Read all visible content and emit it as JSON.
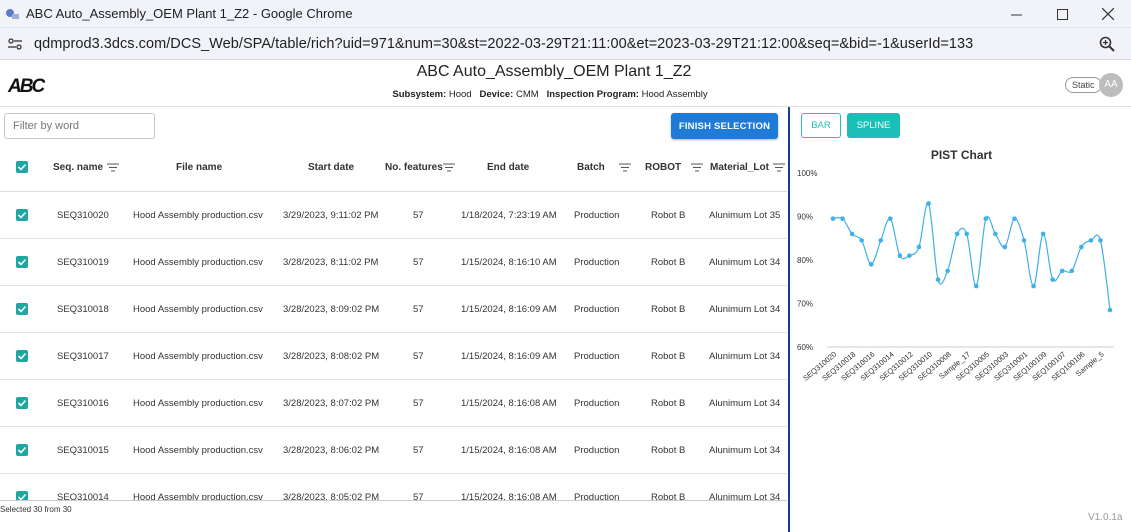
{
  "window": {
    "title": "ABC Auto_Assembly_OEM Plant 1_Z2 - Google Chrome",
    "url": "qdmprod3.3dcs.com/DCS_Web/SPA/table/rich?uid=971&num=30&st=2022-03-29T21:11:00&et=2023-03-29T21:12:00&seq=&bid=-1&userId=133"
  },
  "header": {
    "logo": "ABC",
    "title": "ABC Auto_Assembly_OEM Plant 1_Z2",
    "subsystem_label": "Subsystem:",
    "subsystem": "Hood",
    "device_label": "Device:",
    "device": "CMM",
    "program_label": "Inspection Program:",
    "program": "Hood Assembly",
    "badge": "Static",
    "avatar": "AA"
  },
  "toolbar": {
    "filter_placeholder": "Filter by word",
    "finish_label": "FINISH SELECTION"
  },
  "table": {
    "columns": {
      "seq": "Seq. name",
      "file": "File name",
      "start": "Start date",
      "features": "No. features",
      "end": "End date",
      "batch": "Batch",
      "robot": "ROBOT",
      "lot": "Material_Lot"
    },
    "rows": [
      {
        "seq": "SEQ310020",
        "file": "Hood Assembly production.csv",
        "start": "3/29/2023, 9:11:02 PM",
        "features": "57",
        "end": "1/18/2024, 7:23:19 AM",
        "batch": "Production",
        "robot": "Robot B",
        "lot": "Alunimum Lot 35"
      },
      {
        "seq": "SEQ310019",
        "file": "Hood Assembly production.csv",
        "start": "3/28/2023, 8:11:02 PM",
        "features": "57",
        "end": "1/15/2024, 8:16:10 AM",
        "batch": "Production",
        "robot": "Robot B",
        "lot": "Alunimum Lot 34"
      },
      {
        "seq": "SEQ310018",
        "file": "Hood Assembly production.csv",
        "start": "3/28/2023, 8:09:02 PM",
        "features": "57",
        "end": "1/15/2024, 8:16:09 AM",
        "batch": "Production",
        "robot": "Robot B",
        "lot": "Alunimum Lot 34"
      },
      {
        "seq": "SEQ310017",
        "file": "Hood Assembly production.csv",
        "start": "3/28/2023, 8:08:02 PM",
        "features": "57",
        "end": "1/15/2024, 8:16:09 AM",
        "batch": "Production",
        "robot": "Robot B",
        "lot": "Alunimum Lot 34"
      },
      {
        "seq": "SEQ310016",
        "file": "Hood Assembly production.csv",
        "start": "3/28/2023, 8:07:02 PM",
        "features": "57",
        "end": "1/15/2024, 8:16:08 AM",
        "batch": "Production",
        "robot": "Robot B",
        "lot": "Alunimum Lot 34"
      },
      {
        "seq": "SEQ310015",
        "file": "Hood Assembly production.csv",
        "start": "3/28/2023, 8:06:02 PM",
        "features": "57",
        "end": "1/15/2024, 8:16:08 AM",
        "batch": "Production",
        "robot": "Robot B",
        "lot": "Alunimum Lot 34"
      },
      {
        "seq": "SEQ310014",
        "file": "Hood Assembly production.csv",
        "start": "3/28/2023, 8:05:02 PM",
        "features": "57",
        "end": "1/15/2024, 8:16:08 AM",
        "batch": "Production",
        "robot": "Robot B",
        "lot": "Alunimum Lot 34"
      }
    ]
  },
  "footer": {
    "selected": "Selected 30 from 30",
    "version": "V1.0.1a"
  },
  "chart_buttons": {
    "bar": "BAR",
    "spline": "SPLINE"
  },
  "colors": {
    "accent_blue": "#1e7bd8",
    "teal": "#1bbfb7",
    "line": "#3fb0e8"
  },
  "chart_data": {
    "type": "line",
    "title": "PIST Chart",
    "ylim": [
      60,
      100
    ],
    "yticks": [
      "60%",
      "70%",
      "80%",
      "90%",
      "100%"
    ],
    "x_labels": [
      "SEQ310020",
      "SEQ310018",
      "SEQ310016",
      "SEQ310014",
      "SEQ310012",
      "SEQ310010",
      "SEQ310008",
      "Sample_17",
      "SEQ310005",
      "SEQ310003",
      "SEQ310001",
      "SEQ100109",
      "SEQ100107",
      "SEQ100106",
      "Sample_5"
    ],
    "values": [
      89.5,
      89.5,
      86,
      84.5,
      79,
      84.5,
      89.5,
      81,
      81,
      83,
      93,
      75.5,
      77.5,
      86,
      86,
      74,
      89.5,
      86,
      83,
      89.5,
      84.5,
      74,
      86,
      75.5,
      77.5,
      77.5,
      83,
      84.5,
      84.5,
      68.5
    ],
    "grid": false,
    "legend": "none"
  }
}
